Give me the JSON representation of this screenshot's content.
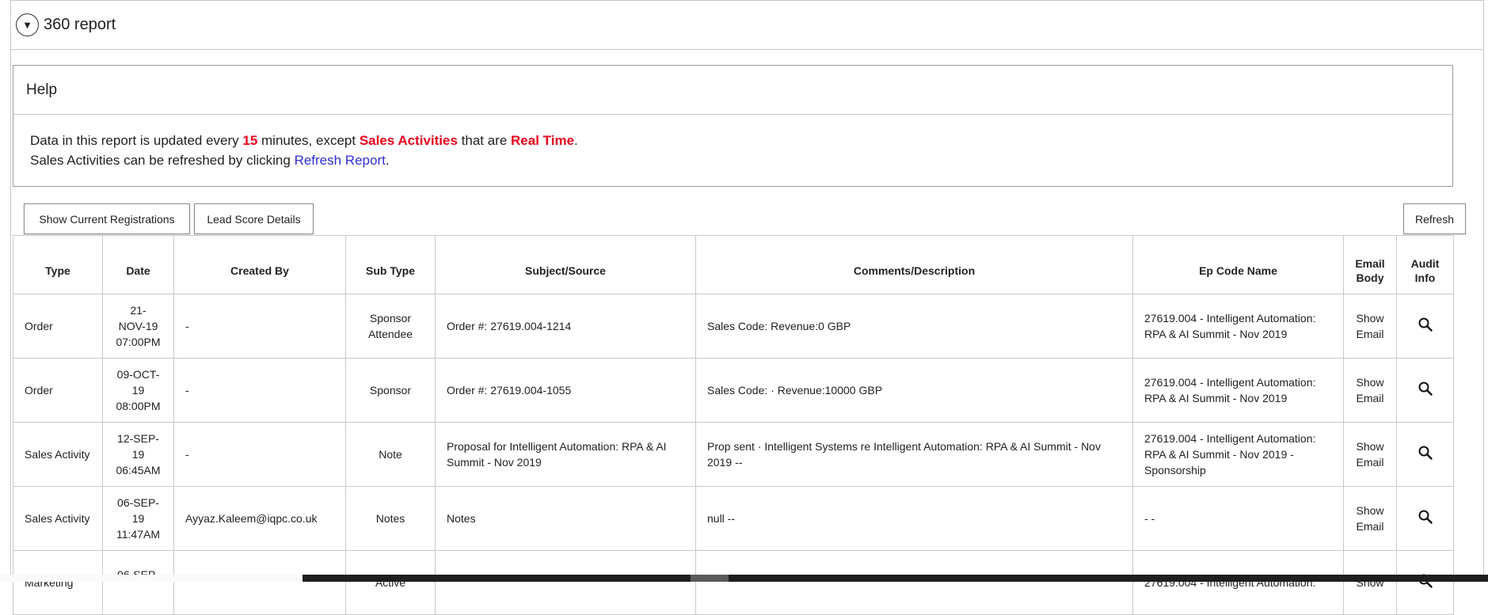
{
  "panel": {
    "toggle_glyph": "▼",
    "title": "360 report"
  },
  "help": {
    "title": "Help",
    "line1_pre": "Data in this report is updated every ",
    "minutes": "15",
    "line1_mid": " minutes, except ",
    "sales_activities": "Sales Activities",
    "line1_mid2": " that are ",
    "real_time": "Real Time",
    "line1_end": ".",
    "line2_pre": "Sales Activities can be refreshed by clicking ",
    "refresh_link": "Refresh Report",
    "line2_end": "."
  },
  "toolbar": {
    "show_registrations": "Show Current Registrations",
    "lead_score": "Lead Score Details",
    "refresh": "Refresh"
  },
  "table": {
    "headers": {
      "type": "Type",
      "date": "Date",
      "created_by": "Created By",
      "sub_type": "Sub Type",
      "subject": "Subject/Source",
      "comments": "Comments/Description",
      "ep_code": "Ep Code Name",
      "email_body_1": "Email",
      "email_body_2": "Body",
      "audit_info_1": "Audit",
      "audit_info_2": "Info"
    },
    "rows": [
      {
        "type": "Order",
        "date": [
          "21-",
          "NOV-19",
          "07:00PM"
        ],
        "created_by": "-",
        "sub_type": [
          "Sponsor",
          "Attendee"
        ],
        "subject": "Order #: 27619.004-1214",
        "comments": "Sales Code: Revenue:0 GBP",
        "ep_code": "27619.004 - Intelligent Automation: RPA & AI Summit - Nov 2019",
        "email": [
          "Show",
          "Email"
        ]
      },
      {
        "type": "Order",
        "date": [
          "09-OCT-",
          "19",
          "08:00PM"
        ],
        "created_by": "-",
        "sub_type": [
          "Sponsor"
        ],
        "subject": "Order #: 27619.004-1055",
        "comments": "Sales Code: ·                  Revenue:10000 GBP",
        "ep_code": "27619.004 - Intelligent Automation: RPA & AI Summit - Nov 2019",
        "email": [
          "Show",
          "Email"
        ]
      },
      {
        "type": "Sales Activity",
        "date": [
          "12-SEP-",
          "19",
          "06:45AM"
        ],
        "created_by": "-",
        "sub_type": [
          "Note"
        ],
        "subject": "Proposal for Intelligent Automation: RPA & AI Summit - Nov 2019",
        "comments": "Prop sent ·                              Intelligent Systems re Intelligent Automation: RPA & AI Summit - Nov 2019 --",
        "ep_code": "27619.004 - Intelligent Automation: RPA & AI Summit - Nov 2019 - Sponsorship",
        "email": [
          "Show",
          "Email"
        ]
      },
      {
        "type": "Sales Activity",
        "date": [
          "06-SEP-",
          "19",
          "11:47AM"
        ],
        "created_by": "Ayyaz.Kaleem@iqpc.co.uk",
        "sub_type": [
          "Notes"
        ],
        "subject": "Notes",
        "comments": "null --",
        "ep_code": "- -",
        "email": [
          "Show",
          "Email"
        ]
      },
      {
        "type": "Marketing",
        "date": [
          "06-SEP-",
          "",
          ""
        ],
        "created_by": "",
        "sub_type": [
          "Active",
          ""
        ],
        "subject": "",
        "comments": "",
        "ep_code": "27619.004 - Intelligent Automation:",
        "email": [
          "Show",
          ""
        ]
      }
    ]
  }
}
